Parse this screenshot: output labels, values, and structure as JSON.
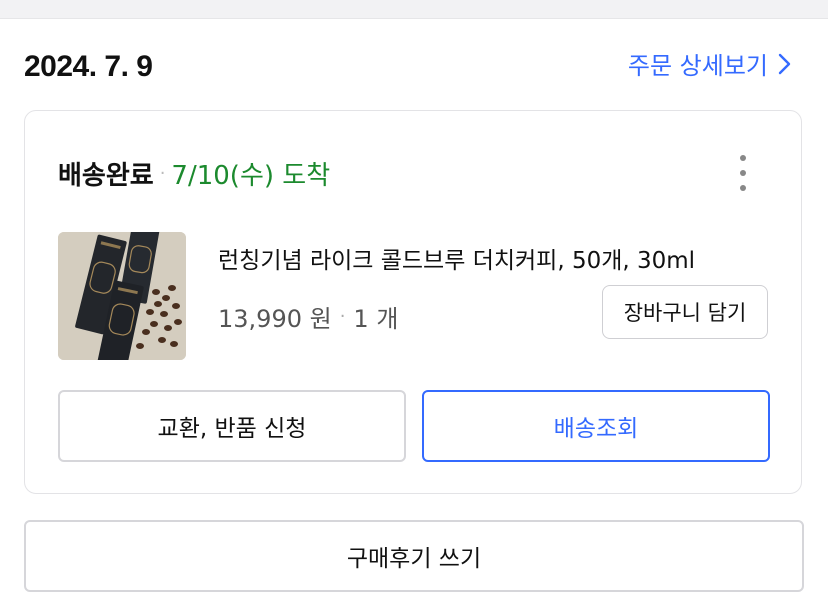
{
  "order": {
    "date": "2024. 7. 9",
    "detail_link_label": "주문 상세보기"
  },
  "shipment": {
    "status": "배송완료",
    "separator": "·",
    "arrival": "7/10(수) 도착"
  },
  "product": {
    "name": "런칭기념 라이크 콜드브루 더치커피, 50개, 30ml",
    "price": "13,990 원",
    "separator": "·",
    "quantity": "1 개",
    "image_icon": "coffee-stick-pack-product-photo"
  },
  "buttons": {
    "add_to_cart": "장바구니 담기",
    "exchange_return": "교환, 반품 신청",
    "track_delivery": "배송조회",
    "write_review": "구매후기 쓰기"
  },
  "colors": {
    "accent_blue": "#346aff",
    "delivered_green": "#1c8a2e"
  }
}
